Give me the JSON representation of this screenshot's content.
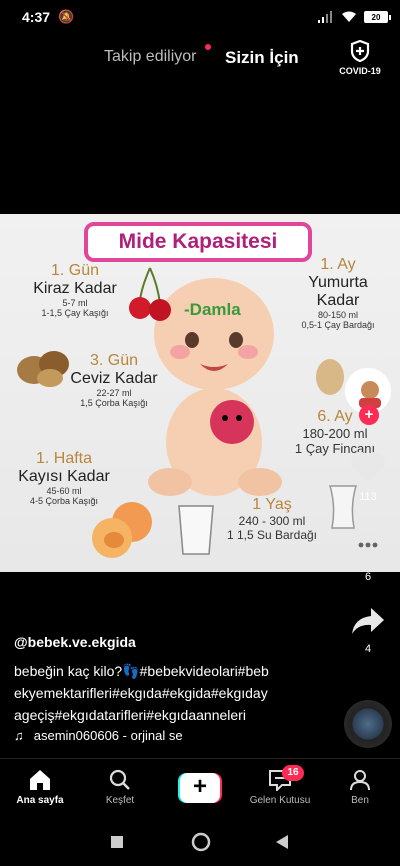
{
  "status_bar": {
    "time": "4:37",
    "battery": "20"
  },
  "top_nav": {
    "following_label": "Takip ediliyor",
    "for_you_label": "Sizin İçin",
    "covid_label": "COVID-19"
  },
  "video": {
    "title": "Mide Kapasitesi",
    "name_tag": "-Damla",
    "stages": [
      {
        "day": "1. Gün",
        "name": "Kiraz Kadar",
        "amount": "5-7 ml",
        "measure": "1-1,5 Çay Kaşığı"
      },
      {
        "day": "3. Gün",
        "name": "Ceviz Kadar",
        "amount": "22-27 ml",
        "measure": "1,5 Çorba Kaşığı"
      },
      {
        "day": "1. Hafta",
        "name": "Kayısı Kadar",
        "amount": "45-60 ml",
        "measure": "4-5 Çorba Kaşığı"
      },
      {
        "day": "1. Ay",
        "name": "Yumurta Kadar",
        "amount": "80-150 ml",
        "measure": "0,5-1 Çay Bardağı"
      },
      {
        "day": "6. Ay",
        "name": "",
        "amount": "180-200 ml",
        "measure": "1 Çay Fincanı"
      },
      {
        "day": "1 Yaş",
        "name": "",
        "amount": "240 - 300 ml",
        "measure": "1 1,5 Su Bardağı"
      }
    ]
  },
  "right_rail": {
    "likes": "113",
    "comments": "6",
    "shares": "4"
  },
  "post": {
    "username": "@bebek.ve.ekgida",
    "caption_line1": "bebeğin kaç kilo?👣#bebekvideolari#beb",
    "caption_line2": "ekyemektarifleri#ekgıda#ekgida#ekgıday",
    "caption_line3": "ageçiş#ekgıdatarifleri#ekgıdaanneleri",
    "sound": "asemin060606 - orjinal se"
  },
  "bottom_nav": {
    "home": "Ana sayfa",
    "discover": "Keşfet",
    "create": "+",
    "inbox": "Gelen Kutusu",
    "inbox_badge": "16",
    "me": "Ben"
  },
  "colors": {
    "accent": "#fe2c55",
    "cyan": "#25f4ee",
    "banner": "#e0479a"
  }
}
